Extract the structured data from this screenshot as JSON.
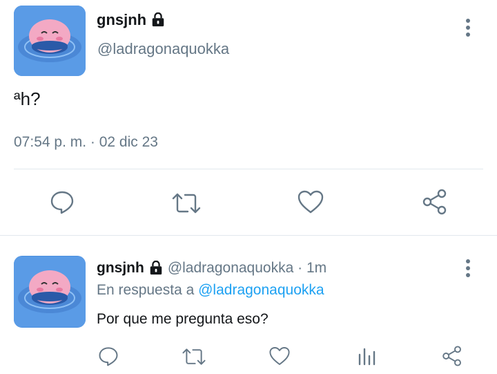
{
  "main_tweet": {
    "display_name": "gnsjnh",
    "handle": "@ladragonaquokka",
    "text": "ªh?",
    "timestamp": "07:54 p. m. · 02 dic 23",
    "avatar_icon": "kirby-in-water-avatar",
    "locked_icon": "lock-icon"
  },
  "actions": {
    "reply_icon": "reply-icon",
    "retweet_icon": "retweet-icon",
    "like_icon": "heart-icon",
    "share_icon": "share-icon",
    "stats_icon": "analytics-icon"
  },
  "reply_tweet": {
    "display_name": "gnsjnh",
    "handle_time": "@ladragonaquokka · 1m",
    "in_reply_prefix": "En respuesta a",
    "in_reply_handle": "@ladragonaquokka",
    "text": "Por que me pregunta eso?"
  },
  "colors": {
    "text_primary": "#14171a",
    "text_secondary": "#657786",
    "link": "#1da1f2",
    "divider": "#e1e8ed",
    "avatar_bg": "#4a8fe0"
  }
}
